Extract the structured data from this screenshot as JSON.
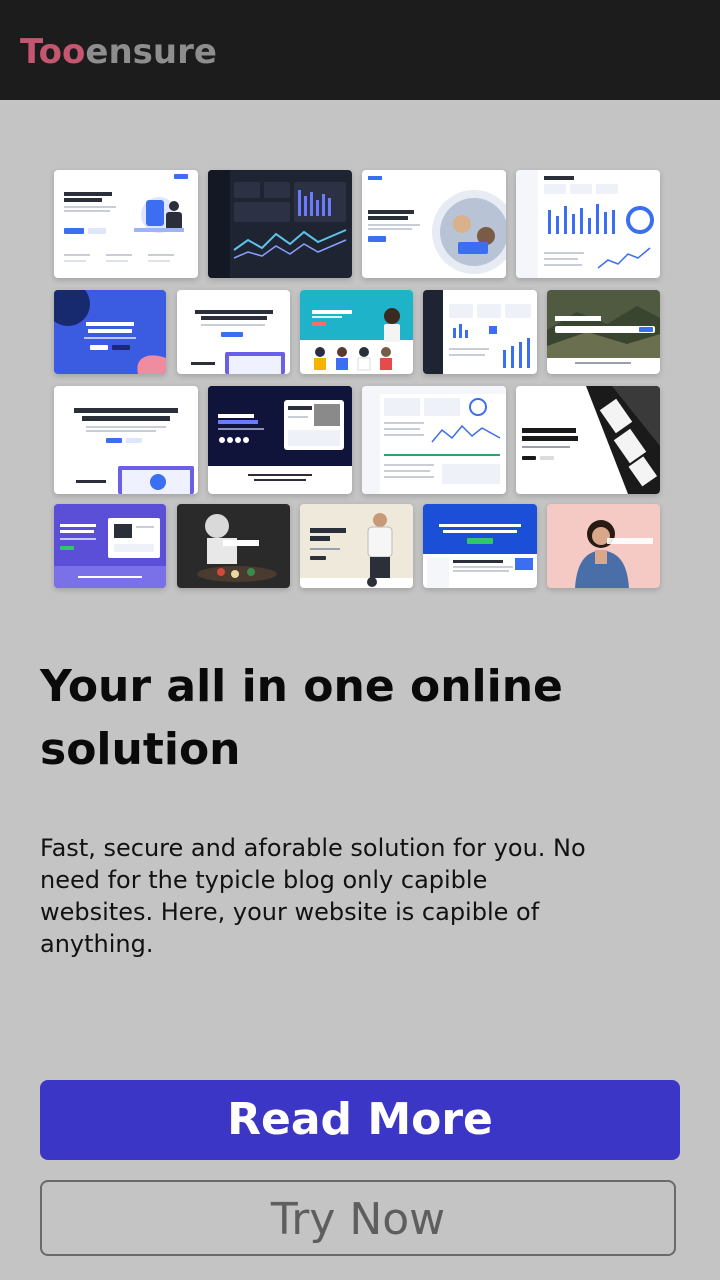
{
  "brand": {
    "logo_part1": "Too",
    "logo_part2": "ensure",
    "accent": "#c4566f",
    "muted": "#8e8e8e"
  },
  "hero": {
    "collage_label": "template preview collage",
    "thumbs": [
      {
        "kind": "landing-illustration",
        "title": "Welcome to Landkit.\nDevelop anything."
      },
      {
        "kind": "dark-dashboard",
        "title": ""
      },
      {
        "kind": "startup",
        "title": "Turn your ideas\ninto a startup"
      },
      {
        "kind": "dashboard",
        "title": "Dashboard"
      },
      {
        "kind": "blue-hero",
        "title": "Launch on time,\nlook on-trend."
      },
      {
        "kind": "saas",
        "title": "A modern design system for\nyour new SaaS platform ."
      },
      {
        "kind": "shop-hero",
        "title": "Huge Summer Collection"
      },
      {
        "kind": "dark-dashboard-2",
        "title": ""
      },
      {
        "kind": "travel",
        "title": "Stay like a local"
      },
      {
        "kind": "saas-2",
        "title": "A modern design system for\nyour new SaaS platform ."
      },
      {
        "kind": "dark-landing",
        "title": "A better way\nto build websites"
      },
      {
        "kind": "admin-light",
        "title": ""
      },
      {
        "kind": "expert",
        "title": "look like an expert\nright from the start"
      },
      {
        "kind": "purple-app",
        "title": "Build stunning\nwebsites and apps"
      },
      {
        "kind": "restaurant",
        "title": "Touché"
      },
      {
        "kind": "fashion",
        "title": "Blouses &\nTops"
      },
      {
        "kind": "docs",
        "title": "Powerful Documentation and Help\nCenter Bootstrap Template."
      },
      {
        "kind": "denim",
        "title": "Denim Jackets"
      }
    ]
  },
  "headline": "Your all in one online solution",
  "description": "Fast, secure and aforable solution for you. No need for the typicle blog only capible websites. Here, your website is capible of anything.",
  "actions": {
    "primary_label": "Read More",
    "secondary_label": "Try Now",
    "primary_color": "#3c36c7"
  }
}
